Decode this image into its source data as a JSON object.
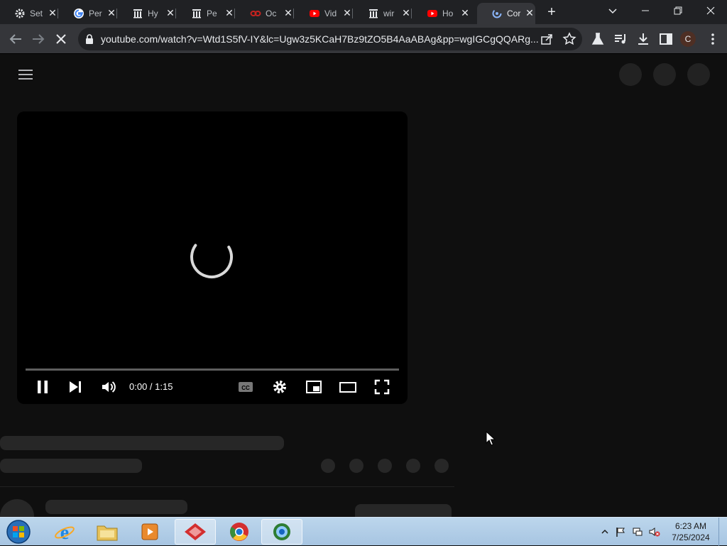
{
  "browser": {
    "tabs": [
      {
        "title": "Set",
        "icon": "gear-icon"
      },
      {
        "title": "Per",
        "icon": "google-icon"
      },
      {
        "title": "Hy",
        "icon": "library-icon"
      },
      {
        "title": "Pe",
        "icon": "library-icon"
      },
      {
        "title": "Oc",
        "icon": "oc-icon"
      },
      {
        "title": "Vid",
        "icon": "youtube-icon"
      },
      {
        "title": "wir",
        "icon": "library-icon"
      },
      {
        "title": "Ho",
        "icon": "youtube-icon"
      },
      {
        "title": "Cor",
        "icon": "loading-icon",
        "active": true
      }
    ],
    "new_tab_label": "+",
    "url": "youtube.com/watch?v=Wtd1S5fV-IY&lc=Ugw3z5KCaH7Bz9tZO5B4AaABAg&pp=wgIGCgQQARg...",
    "profile_initial": "C"
  },
  "player": {
    "time_display": "0:00 / 1:15",
    "progress": 0.0,
    "state": "loading"
  },
  "taskbar": {
    "time": "6:23 AM",
    "date": "7/25/2024"
  },
  "colors": {
    "page_bg": "#0f0f0f",
    "player_bg": "#000000",
    "skeleton": "#272727",
    "tab_strip": "#202124",
    "toolbar": "#35363a"
  }
}
